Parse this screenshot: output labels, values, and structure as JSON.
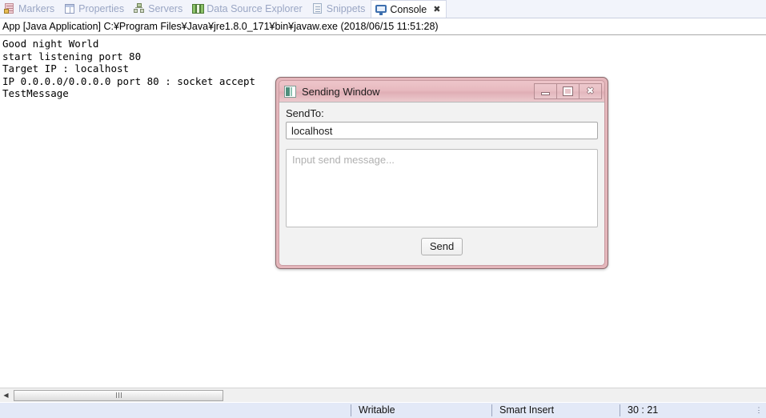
{
  "tabbar": {
    "tabs": [
      {
        "label": "Markers",
        "icon": "markers-icon",
        "active": false
      },
      {
        "label": "Properties",
        "icon": "properties-icon",
        "active": false
      },
      {
        "label": "Servers",
        "icon": "servers-icon",
        "active": false
      },
      {
        "label": "Data Source Explorer",
        "icon": "data-source-explorer-icon",
        "active": false
      },
      {
        "label": "Snippets",
        "icon": "snippets-icon",
        "active": false
      },
      {
        "label": "Console",
        "icon": "console-icon",
        "active": true
      }
    ],
    "close_glyph": "✖"
  },
  "console": {
    "header": "App [Java Application] C:¥Program Files¥Java¥jre1.8.0_171¥bin¥javaw.exe (2018/06/15 11:51:28)",
    "lines": [
      "Good night World",
      "start listening port 80",
      "Target IP : localhost",
      "IP 0.0.0.0/0.0.0.0 port 80 : socket accept",
      "TestMessage"
    ]
  },
  "dialog": {
    "title": "Sending Window",
    "icon": "java-app-icon",
    "window_buttons": {
      "minimize": "minimize-button",
      "maximize": "maximize-button",
      "close_label": "✖"
    },
    "sendto_label": "SendTo:",
    "sendto_value": "localhost",
    "message_placeholder": "Input send message...",
    "message_value": "",
    "send_label": "Send",
    "accent_color": "#e4b6bb",
    "titlebar_color": "#e7b9bf"
  },
  "scrollbar": {
    "left_arrow_glyph": "◀"
  },
  "statusbar": {
    "writable": "Writable",
    "insert_mode": "Smart Insert",
    "cursor_position": "30 : 21",
    "overflow_glyph": "⋮"
  }
}
